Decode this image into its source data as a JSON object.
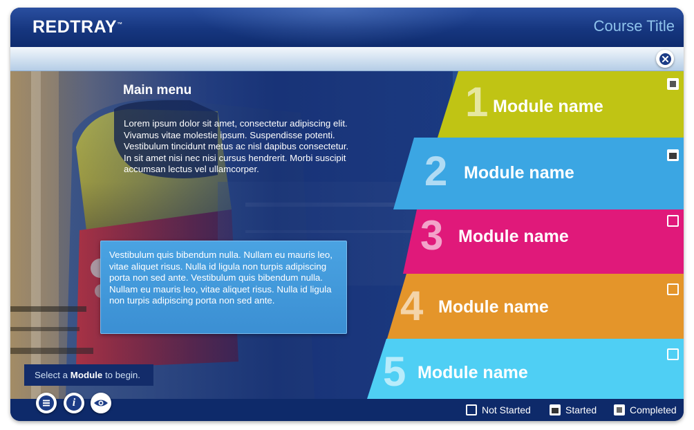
{
  "header": {
    "brand": "REDTRAY",
    "brand_tm": "™",
    "course_title": "Course Title"
  },
  "toolbar": {
    "close_icon": "close-icon"
  },
  "main": {
    "title": "Main menu",
    "intro": "Lorem ipsum dolor sit amet, consectetur adipiscing elit. Vivamus vitae molestie ipsum. Suspendisse potenti. Vestibulum tincidunt metus ac nisl dapibus consectetur. In sit amet nisi nec nisi cursus hendrerit. Morbi suscipit accumsan lectus vel ullamcorper.",
    "info": "Vestibulum quis bibendum nulla. Nullam eu mauris leo, vitae aliquet risus. Nulla id ligula non turpis adipiscing porta non sed ante. Vestibulum quis bibendum nulla. Nullam eu mauris leo, vitae aliquet risus. Nulla id ligula non turpis adipiscing porta non sed ante.",
    "prompt_pre": "Select a ",
    "prompt_bold": "Module",
    "prompt_post": " to begin."
  },
  "modules": [
    {
      "number": "1",
      "label": "Module name",
      "color": "#c0c414",
      "status": "completed"
    },
    {
      "number": "2",
      "label": "Module name",
      "color": "#3ba6e3",
      "status": "started"
    },
    {
      "number": "3",
      "label": "Module name",
      "color": "#e0197a",
      "status": "not-started"
    },
    {
      "number": "4",
      "label": "Module name",
      "color": "#e4952a",
      "status": "not-started"
    },
    {
      "number": "5",
      "label": "Module name",
      "color": "#4fcff4",
      "status": "not-started"
    }
  ],
  "footer": {
    "tools": [
      "menu-icon",
      "info-icon",
      "eye-icon"
    ],
    "legend": {
      "not_started": "Not Started",
      "started": "Started",
      "completed": "Completed"
    }
  }
}
